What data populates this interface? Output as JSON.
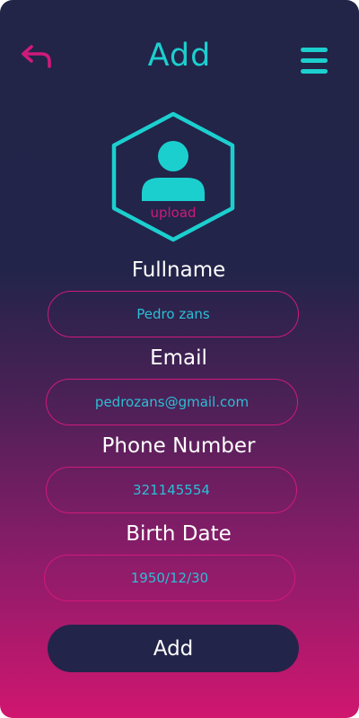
{
  "header": {
    "title": "Add",
    "back_icon": "back-arrow-icon",
    "menu_icon": "hamburger-menu-icon"
  },
  "avatar": {
    "icon": "user-avatar-icon",
    "upload_label": "upload"
  },
  "form": {
    "fullname": {
      "label": "Fullname",
      "value": "Pedro zans"
    },
    "email": {
      "label": "Email",
      "value": "pedrozans@gmail.com"
    },
    "phone": {
      "label": "Phone Number",
      "value": "321145554"
    },
    "birth_date": {
      "label": "Birth Date",
      "value": "1950/12/30"
    }
  },
  "submit": {
    "label": "Add"
  },
  "colors": {
    "accent_cyan": "#1ccfcf",
    "accent_pink": "#cf1a7a",
    "field_text": "#2bbfd6",
    "button_bg": "#232449",
    "gradient_top": "#222548",
    "gradient_bottom": "#d0166f"
  }
}
